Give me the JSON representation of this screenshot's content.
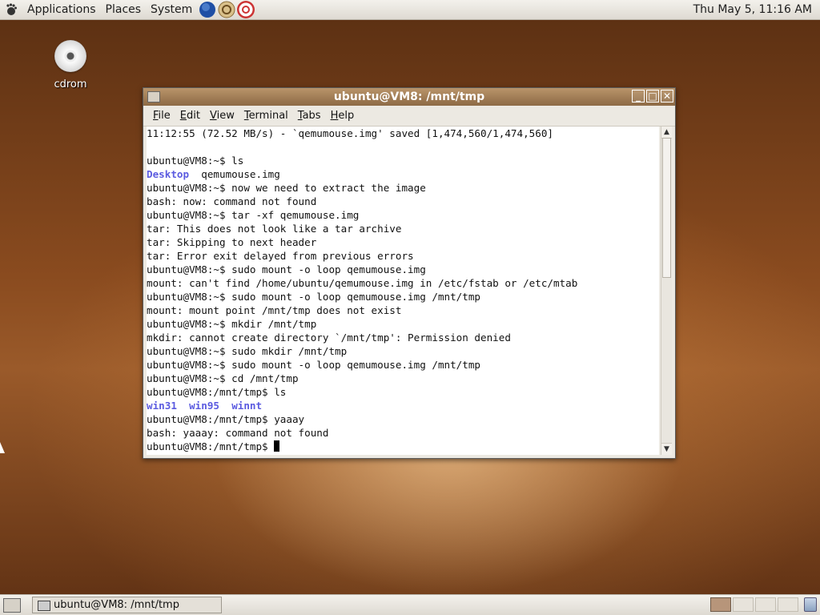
{
  "top_panel": {
    "menus": [
      "Applications",
      "Places",
      "System"
    ],
    "launchers": [
      "web-browser-icon",
      "mail-icon",
      "help-icon"
    ],
    "clock": "Thu May  5, 11:16 AM"
  },
  "desktop": {
    "icons": [
      {
        "label": "cdrom",
        "icon": "cdrom-icon"
      }
    ]
  },
  "terminal": {
    "title": "ubuntu@VM8: /mnt/tmp",
    "menu": [
      {
        "label": "File",
        "accel": "F",
        "rest": "ile"
      },
      {
        "label": "Edit",
        "accel": "E",
        "rest": "dit"
      },
      {
        "label": "View",
        "accel": "V",
        "rest": "iew"
      },
      {
        "label": "Terminal",
        "accel": "T",
        "rest": "erminal"
      },
      {
        "label": "Tabs",
        "accel": "T",
        "rest": "abs"
      },
      {
        "label": "Help",
        "accel": "H",
        "rest": "elp"
      }
    ],
    "lines": [
      "11:12:55 (72.52 MB/s) - `qemumouse.img' saved [1,474,560/1,474,560]",
      "",
      "ubuntu@VM8:~$ ls",
      "Desktop  qemumouse.img",
      "ubuntu@VM8:~$ now we need to extract the image",
      "bash: now: command not found",
      "ubuntu@VM8:~$ tar -xf qemumouse.img",
      "tar: This does not look like a tar archive",
      "tar: Skipping to next header",
      "tar: Error exit delayed from previous errors",
      "ubuntu@VM8:~$ sudo mount -o loop qemumouse.img",
      "mount: can't find /home/ubuntu/qemumouse.img in /etc/fstab or /etc/mtab",
      "ubuntu@VM8:~$ sudo mount -o loop qemumouse.img /mnt/tmp",
      "mount: mount point /mnt/tmp does not exist",
      "ubuntu@VM8:~$ mkdir /mnt/tmp",
      "mkdir: cannot create directory `/mnt/tmp': Permission denied",
      "ubuntu@VM8:~$ sudo mkdir /mnt/tmp",
      "ubuntu@VM8:~$ sudo mount -o loop qemumouse.img /mnt/tmp",
      "ubuntu@VM8:~$ cd /mnt/tmp",
      "ubuntu@VM8:/mnt/tmp$ ls",
      "win31  win95  winnt",
      "ubuntu@VM8:/mnt/tmp$ yaaay",
      "bash: yaaay: command not found",
      "ubuntu@VM8:/mnt/tmp$ "
    ],
    "blue_words": {
      "3": [
        "Desktop"
      ],
      "20": [
        "win31",
        "win95",
        "winnt"
      ]
    }
  },
  "bottom_panel": {
    "task_label": "ubuntu@VM8: /mnt/tmp",
    "workspaces": 4,
    "active_workspace": 0
  }
}
